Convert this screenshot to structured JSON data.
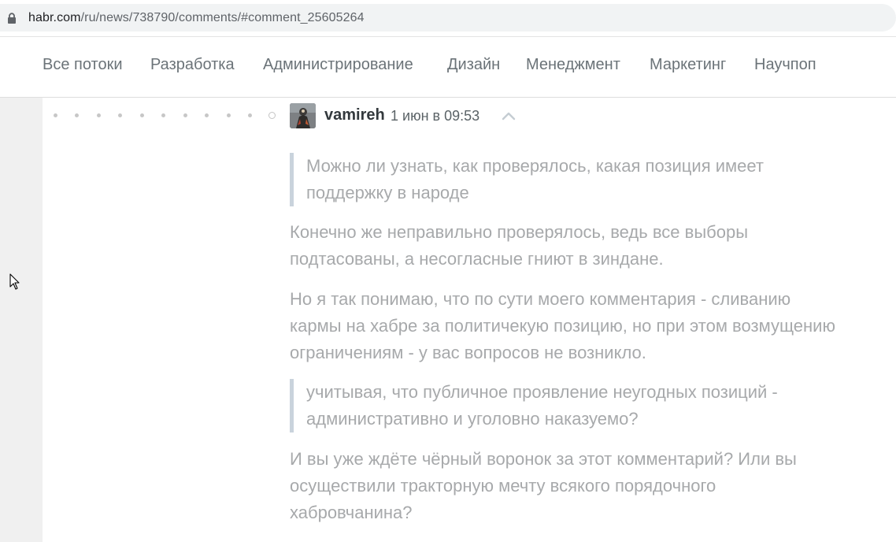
{
  "browser": {
    "url_host": "habr.com",
    "url_path": "/ru/news/738790/comments/#comment_25605264"
  },
  "nav": {
    "items": [
      "Все потоки",
      "Разработка",
      "Администрирование",
      "Дизайн",
      "Менеджмент",
      "Маркетинг",
      "Научпоп"
    ]
  },
  "comment": {
    "username": "vamireh",
    "date": "1 июн в 09:53",
    "quote1_line1": "Можно ли узнать, как проверялось, какая позиция имеет",
    "quote1_line2": "поддержку в народе",
    "para1_line1": "Конечно же неправильно проверялось, ведь все выборы",
    "para1_line2": "подтасованы, а несогласные гниют в зиндане.",
    "para2_line1": "Но я так понимаю, что по сути моего комментария - сливанию",
    "para2_line2": "кармы на хабре за политичекую позицию, но при этом возмущению",
    "para2_line3": "ограничениям - у вас вопросов не возникло.",
    "quote2_line1": "учитывая, что публичное проявление неугодных позиций -",
    "quote2_line2": "административно и уголовно наказуемо?",
    "para3_line1": "И вы уже ждёте чёрный воронок за этот комментарий? Или вы",
    "para3_line2": "осуществили тракторную мечту всякого порядочного",
    "para3_line3": "хабровчанина?"
  },
  "icons": {
    "lock": "lock-icon",
    "avatar": "user-avatar",
    "collapse": "chevron-up-icon",
    "cursor": "mouse-pointer-icon"
  },
  "colors": {
    "text_muted": "#a7a9ab",
    "quote_border": "#c9d3dc",
    "nav_text": "#6b7378",
    "background": "#f0f0f0"
  }
}
